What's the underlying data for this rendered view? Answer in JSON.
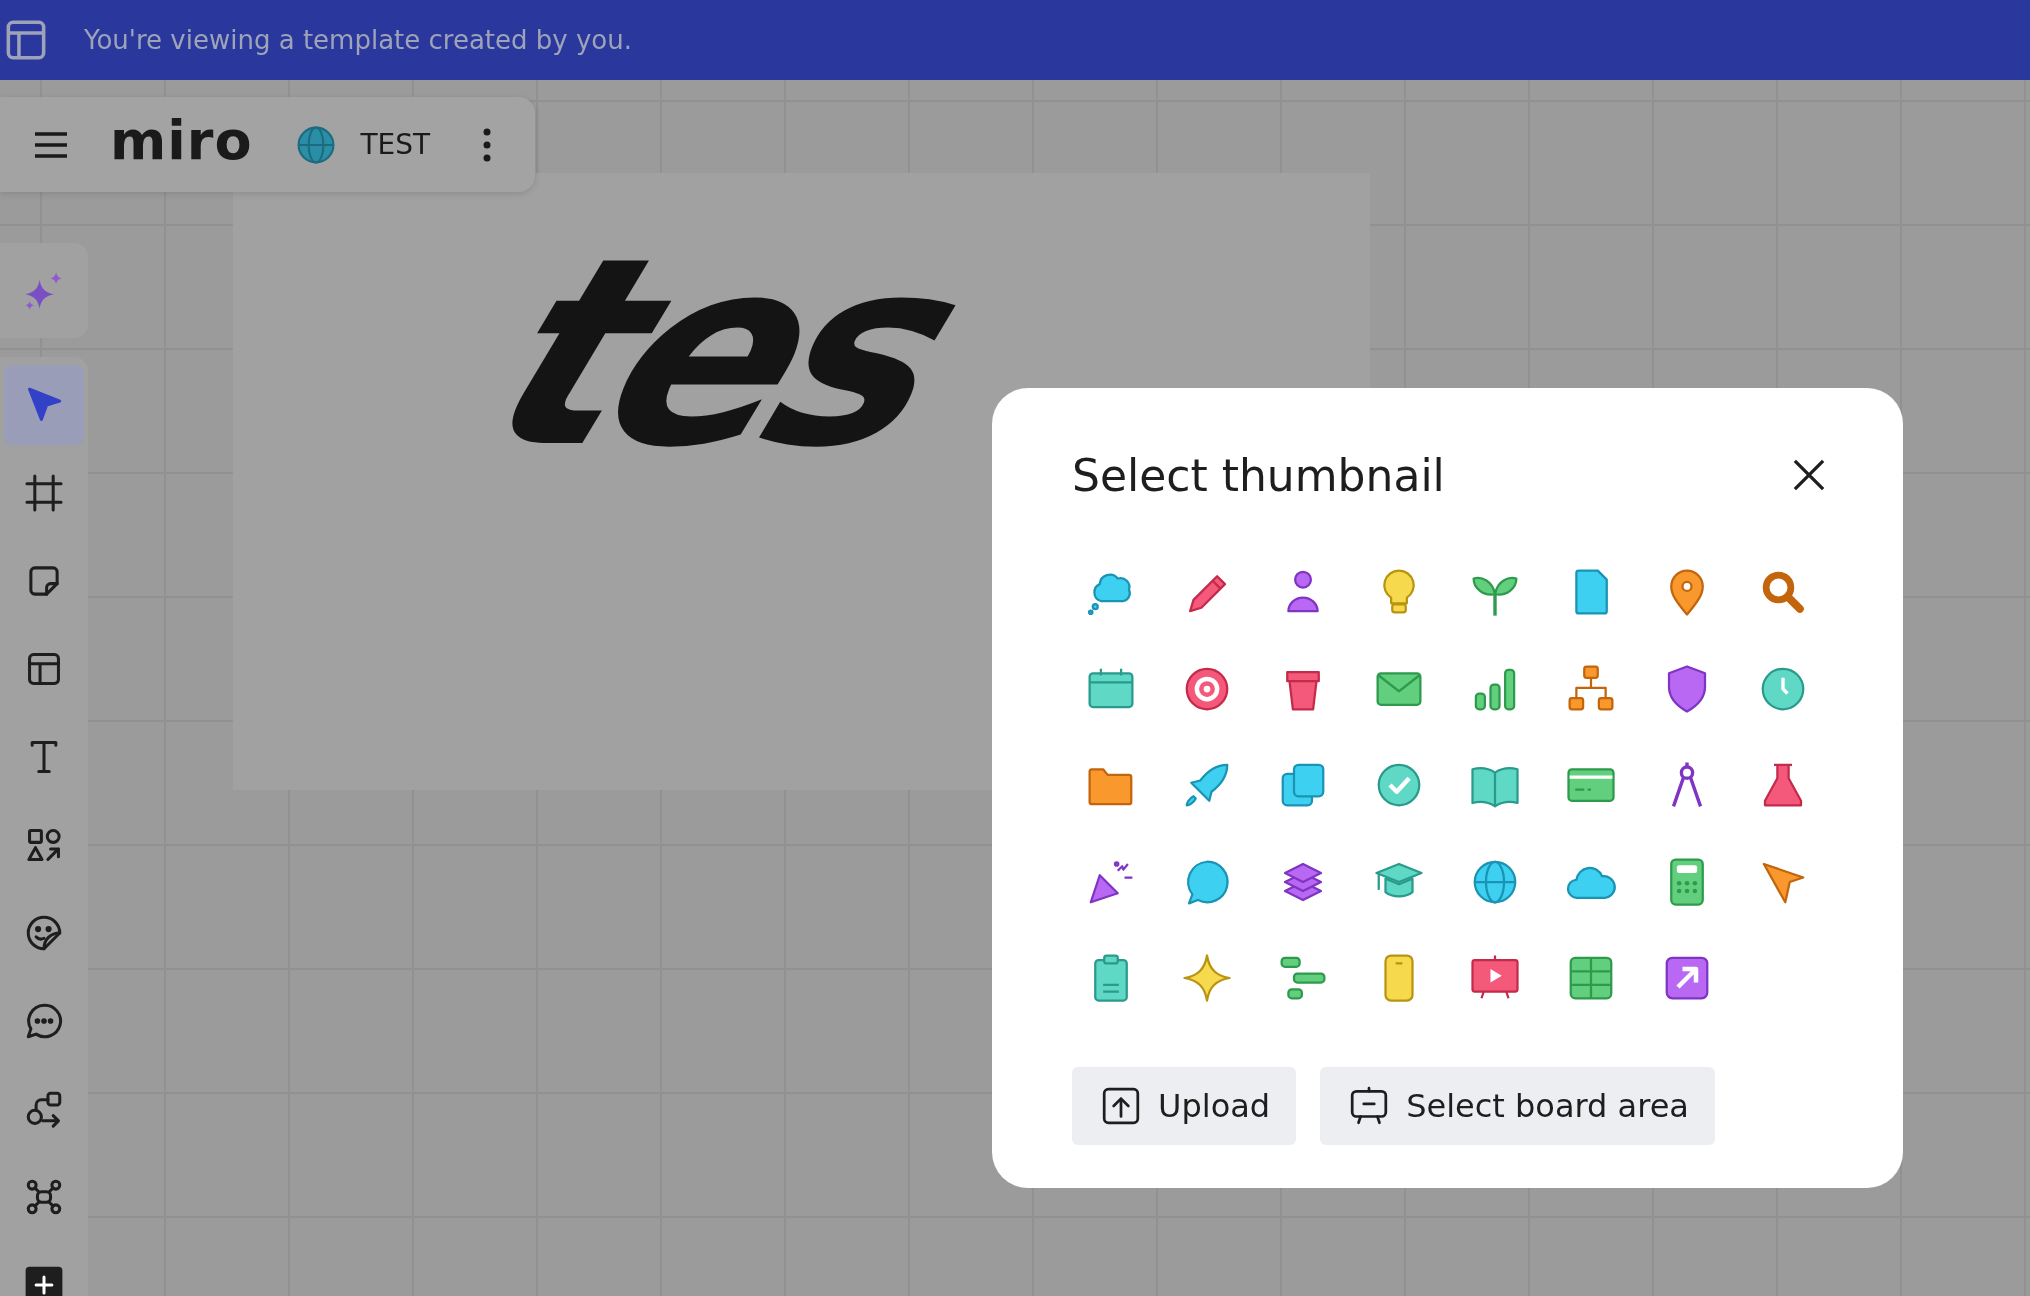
{
  "banner": {
    "text": "You're viewing a template created by you."
  },
  "board_bar": {
    "logo": "miro",
    "board_name": "TEST"
  },
  "tools": [
    {
      "kind": "select",
      "selected": true
    },
    {
      "kind": "frame",
      "selected": false
    },
    {
      "kind": "sticky_note",
      "selected": false
    },
    {
      "kind": "template",
      "selected": false
    },
    {
      "kind": "text",
      "selected": false
    },
    {
      "kind": "shapes",
      "selected": false
    },
    {
      "kind": "sticker",
      "selected": false
    },
    {
      "kind": "comment",
      "selected": false
    },
    {
      "kind": "diagram",
      "selected": false
    },
    {
      "kind": "mind_map",
      "selected": false
    },
    {
      "kind": "add",
      "selected": false
    }
  ],
  "canvas": {
    "frame_text": "tes"
  },
  "dialog": {
    "title": "Select thumbnail",
    "buttons": [
      {
        "kind": "upload",
        "label": "Upload"
      },
      {
        "kind": "board_area",
        "label": "Select board area"
      }
    ]
  }
}
